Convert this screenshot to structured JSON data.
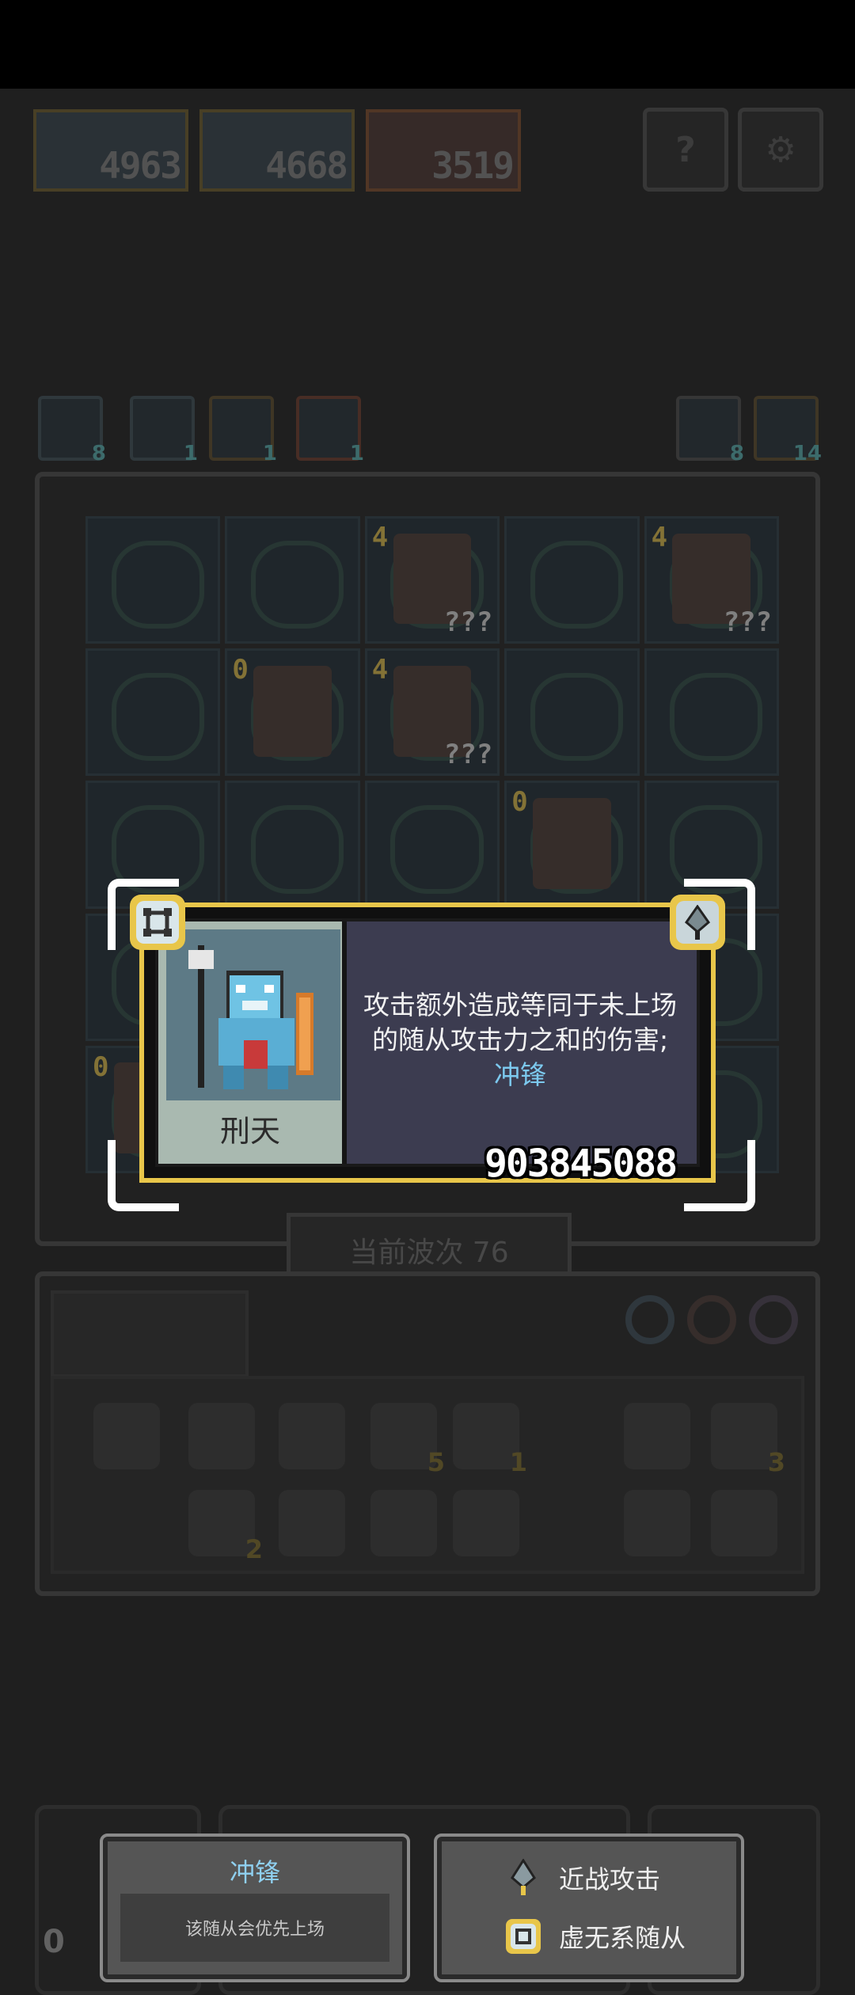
{
  "header": {
    "hero_scores": [
      "4963",
      "4668",
      "3519"
    ],
    "help_label": "?",
    "settings_label": "⚙"
  },
  "resources": [
    "8",
    "1",
    "1",
    "1"
  ],
  "right_counts": [
    "8",
    "14"
  ],
  "board": {
    "cells": [
      {
        "lvl": "",
        "badge": ""
      },
      {
        "lvl": "",
        "badge": ""
      },
      {
        "lvl": "4",
        "badge": "???"
      },
      {
        "lvl": "",
        "badge": ""
      },
      {
        "lvl": "4",
        "badge": "???"
      },
      {
        "lvl": "",
        "badge": ""
      },
      {
        "lvl": "0",
        "badge": ""
      },
      {
        "lvl": "4",
        "badge": "???"
      },
      {
        "lvl": "",
        "badge": ""
      },
      {
        "lvl": "",
        "badge": ""
      },
      {
        "lvl": "",
        "badge": ""
      },
      {
        "lvl": "",
        "badge": ""
      },
      {
        "lvl": "",
        "badge": ""
      },
      {
        "lvl": "0",
        "badge": ""
      },
      {
        "lvl": "",
        "badge": ""
      },
      {
        "lvl": "",
        "badge": ""
      },
      {
        "lvl": "",
        "badge": ""
      },
      {
        "lvl": "",
        "badge": ""
      },
      {
        "lvl": "",
        "badge": ""
      },
      {
        "lvl": "",
        "badge": ""
      },
      {
        "lvl": "0",
        "badge": ""
      },
      {
        "lvl": "",
        "badge": ""
      },
      {
        "lvl": "",
        "badge": ""
      },
      {
        "lvl": "",
        "badge": ""
      },
      {
        "lvl": "",
        "badge": ""
      }
    ]
  },
  "wave": {
    "label": "当前波次 76"
  },
  "shop": {
    "item_counts": [
      "5",
      "1",
      "3",
      "2"
    ]
  },
  "card": {
    "hero_name": "刑天",
    "description": "攻击额外造成等同于未上场的随从攻击力之和的伤害;",
    "keyword": "冲锋",
    "number": "903845088"
  },
  "tooltip_keyword": {
    "title": "冲锋",
    "body": "该随从会优先上场"
  },
  "tooltip_tags": {
    "melee": "近战攻击",
    "void": "虚无系随从"
  },
  "bottom_left_count": "0",
  "colors": {
    "gold": "#e8c64a",
    "keyword": "#7cc9ee",
    "card_bg": "#3c3c50"
  }
}
